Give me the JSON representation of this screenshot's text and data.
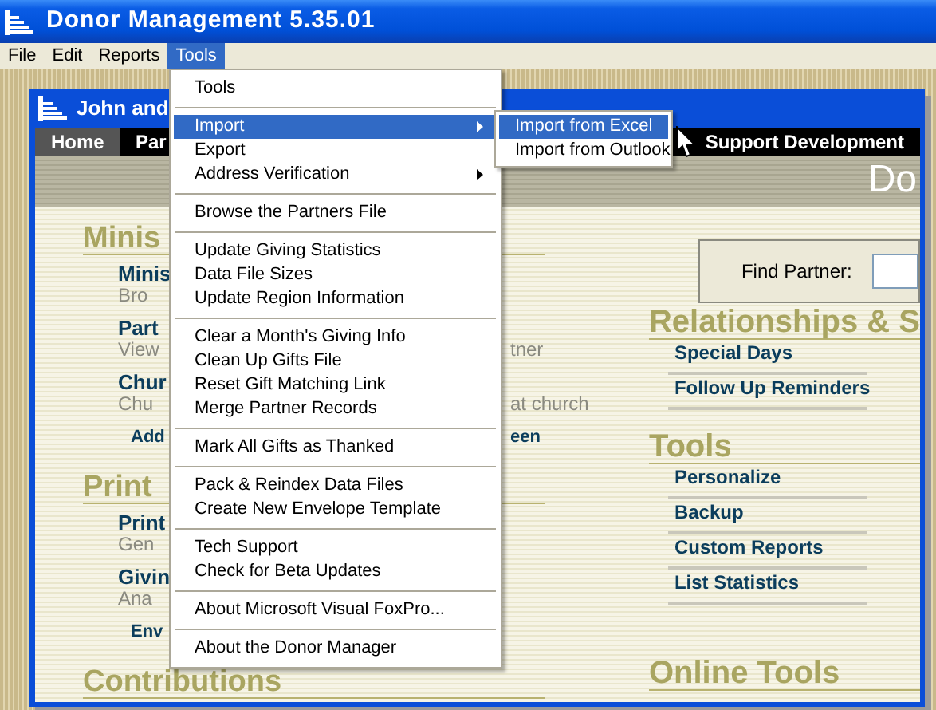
{
  "window": {
    "title": "Donor Management 5.35.01"
  },
  "menubar": [
    {
      "label": "File",
      "selected": false
    },
    {
      "label": "Edit",
      "selected": false
    },
    {
      "label": "Reports",
      "selected": false
    },
    {
      "label": "Tools",
      "selected": true
    }
  ],
  "tools_menu": [
    {
      "kind": "item",
      "label": "Tools",
      "selected": false,
      "submenu": false
    },
    {
      "kind": "separator"
    },
    {
      "kind": "item",
      "label": "Import",
      "selected": true,
      "submenu": true
    },
    {
      "kind": "item",
      "label": "Export",
      "selected": false,
      "submenu": false
    },
    {
      "kind": "item",
      "label": "Address Verification",
      "selected": false,
      "submenu": true
    },
    {
      "kind": "separator"
    },
    {
      "kind": "item",
      "label": "Browse the Partners File",
      "selected": false,
      "submenu": false
    },
    {
      "kind": "separator"
    },
    {
      "kind": "item",
      "label": "Update Giving Statistics",
      "selected": false,
      "submenu": false
    },
    {
      "kind": "item",
      "label": "Data File Sizes",
      "selected": false,
      "submenu": false
    },
    {
      "kind": "item",
      "label": "Update Region Information",
      "selected": false,
      "submenu": false
    },
    {
      "kind": "separator"
    },
    {
      "kind": "item",
      "label": "Clear a Month's Giving Info",
      "selected": false,
      "submenu": false
    },
    {
      "kind": "item",
      "label": "Clean Up Gifts File",
      "selected": false,
      "submenu": false
    },
    {
      "kind": "item",
      "label": "Reset Gift Matching Link",
      "selected": false,
      "submenu": false
    },
    {
      "kind": "item",
      "label": "Merge Partner Records",
      "selected": false,
      "submenu": false
    },
    {
      "kind": "separator"
    },
    {
      "kind": "item",
      "label": "Mark All Gifts as Thanked",
      "selected": false,
      "submenu": false
    },
    {
      "kind": "separator"
    },
    {
      "kind": "item",
      "label": "Pack & Reindex Data Files",
      "selected": false,
      "submenu": false
    },
    {
      "kind": "item",
      "label": "Create New Envelope Template",
      "selected": false,
      "submenu": false
    },
    {
      "kind": "separator"
    },
    {
      "kind": "item",
      "label": "Tech Support",
      "selected": false,
      "submenu": false
    },
    {
      "kind": "item",
      "label": "Check for Beta Updates",
      "selected": false,
      "submenu": false
    },
    {
      "kind": "separator"
    },
    {
      "kind": "item",
      "label": "About Microsoft Visual FoxPro...",
      "selected": false,
      "submenu": false
    },
    {
      "kind": "separator"
    },
    {
      "kind": "item",
      "label": "About the Donor Manager",
      "selected": false,
      "submenu": false
    }
  ],
  "import_submenu": [
    {
      "label": "Import from Excel",
      "selected": true
    },
    {
      "label": "Import from Outlook",
      "selected": false
    }
  ],
  "inner_window": {
    "title": "John and",
    "nav_tabs": [
      {
        "label": "Home",
        "selected": true
      },
      {
        "label": "Par",
        "selected": false
      },
      {
        "label": "Support Development",
        "selected": false
      }
    ],
    "banner": "Do",
    "left_sections": [
      {
        "heading": "Minis",
        "rows": [
          {
            "kind": "title",
            "text": "Minis"
          },
          {
            "kind": "desc",
            "text": "Bro"
          },
          {
            "kind": "title",
            "text": "Part"
          },
          {
            "kind": "desc",
            "text": "View",
            "tail": "tner"
          },
          {
            "kind": "title",
            "text": "Chur"
          },
          {
            "kind": "desc",
            "text": "Chu",
            "tail": "at church"
          },
          {
            "kind": "link",
            "text": "Add",
            "tail": "een"
          }
        ]
      },
      {
        "heading": "Print",
        "rows": [
          {
            "kind": "title",
            "text": "Print"
          },
          {
            "kind": "desc",
            "text": "Gen"
          },
          {
            "kind": "title",
            "text": "Givin"
          },
          {
            "kind": "desc",
            "text": "Ana"
          },
          {
            "kind": "link",
            "text": "Env"
          }
        ]
      },
      {
        "heading": "Contributions"
      }
    ],
    "find_partner": {
      "label": "Find Partner:"
    },
    "right_sections": [
      {
        "heading": "Relationships & S",
        "links": [
          "Special Days",
          "Follow Up Reminders"
        ]
      },
      {
        "heading": "Tools",
        "links": [
          "Personalize",
          "Backup",
          "Custom Reports",
          "List Statistics"
        ]
      },
      {
        "heading": "Online Tools"
      }
    ]
  }
}
